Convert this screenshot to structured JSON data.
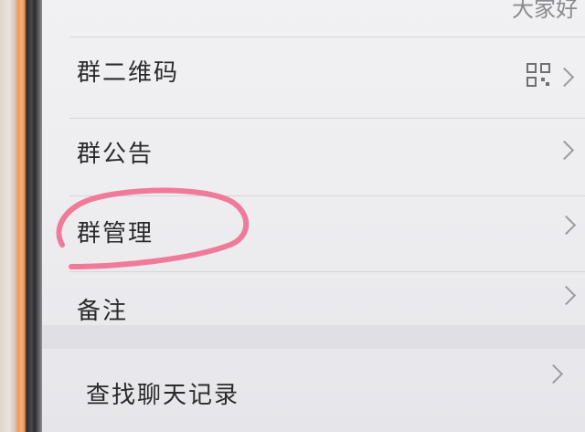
{
  "top_partial": {
    "value": "大家好"
  },
  "menu": {
    "items": [
      {
        "label": "群二维码"
      },
      {
        "label": "群公告"
      },
      {
        "label": "群管理"
      },
      {
        "label": "备注"
      },
      {
        "label": "查找聊天记录"
      }
    ]
  },
  "icons": {
    "qr": "qr-code-icon",
    "chevron": "chevron-right-icon"
  },
  "annotation": {
    "highlight_color": "#f07a9a"
  }
}
